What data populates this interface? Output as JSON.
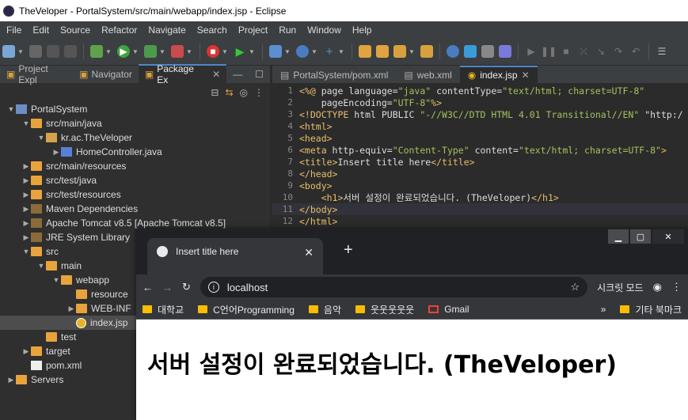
{
  "window": {
    "title": "TheVeloper - PortalSystem/src/main/webapp/index.jsp - Eclipse"
  },
  "menu": [
    "File",
    "Edit",
    "Source",
    "Refactor",
    "Navigate",
    "Search",
    "Project",
    "Run",
    "Window",
    "Help"
  ],
  "left_tabs": [
    {
      "label": "Project Expl"
    },
    {
      "label": "Navigator"
    },
    {
      "label": "Package Ex"
    }
  ],
  "tree": [
    {
      "indent": 0,
      "arrow": "▼",
      "icon": "proj",
      "label": "PortalSystem"
    },
    {
      "indent": 1,
      "arrow": "▼",
      "icon": "folder",
      "label": "src/main/java"
    },
    {
      "indent": 2,
      "arrow": "▼",
      "icon": "pkg",
      "label": "kr.ac.TheVeloper"
    },
    {
      "indent": 3,
      "arrow": "▶",
      "icon": "javaf",
      "label": "HomeController.java"
    },
    {
      "indent": 1,
      "arrow": "▶",
      "icon": "folder",
      "label": "src/main/resources"
    },
    {
      "indent": 1,
      "arrow": "▶",
      "icon": "folder",
      "label": "src/test/java"
    },
    {
      "indent": 1,
      "arrow": "▶",
      "icon": "folder",
      "label": "src/test/resources"
    },
    {
      "indent": 1,
      "arrow": "▶",
      "icon": "jar",
      "label": "Maven Dependencies"
    },
    {
      "indent": 1,
      "arrow": "▶",
      "icon": "jar",
      "label": "Apache Tomcat v8.5 [Apache Tomcat v8.5]"
    },
    {
      "indent": 1,
      "arrow": "▶",
      "icon": "jar",
      "label": "JRE System Library"
    },
    {
      "indent": 1,
      "arrow": "▼",
      "icon": "folder",
      "label": "src"
    },
    {
      "indent": 2,
      "arrow": "▼",
      "icon": "folder",
      "label": "main"
    },
    {
      "indent": 3,
      "arrow": "▼",
      "icon": "folder",
      "label": "webapp"
    },
    {
      "indent": 4,
      "arrow": "",
      "icon": "folder",
      "label": "resource"
    },
    {
      "indent": 4,
      "arrow": "▶",
      "icon": "folder",
      "label": "WEB-INF"
    },
    {
      "indent": 4,
      "arrow": "",
      "icon": "globe",
      "label": "index.jsp",
      "selected": true
    },
    {
      "indent": 2,
      "arrow": "",
      "icon": "folder",
      "label": "test"
    },
    {
      "indent": 1,
      "arrow": "▶",
      "icon": "folder",
      "label": "target"
    },
    {
      "indent": 1,
      "arrow": "",
      "icon": "file",
      "label": "pom.xml"
    },
    {
      "indent": 0,
      "arrow": "▶",
      "icon": "folder",
      "label": "Servers"
    }
  ],
  "editor_tabs": [
    {
      "label": "PortalSystem/pom.xml"
    },
    {
      "label": "web.xml"
    },
    {
      "label": "index.jsp",
      "active": true
    }
  ],
  "code": [
    {
      "n": "1",
      "text": "<%@ page language=\"java\" contentType=\"text/html; charset=UTF-8\""
    },
    {
      "n": "2",
      "text": "    pageEncoding=\"UTF-8\"%>"
    },
    {
      "n": "3",
      "text": "<!DOCTYPE html PUBLIC \"-//W3C//DTD HTML 4.01 Transitional//EN\" \"http:/"
    },
    {
      "n": "4",
      "text": "<html>"
    },
    {
      "n": "5",
      "text": "<head>"
    },
    {
      "n": "6",
      "text": "<meta http-equiv=\"Content-Type\" content=\"text/html; charset=UTF-8\">"
    },
    {
      "n": "7",
      "text": "<title>Insert title here</title>"
    },
    {
      "n": "8",
      "text": "</head>"
    },
    {
      "n": "9",
      "text": "<body>"
    },
    {
      "n": "10",
      "text": "    <h1>서버 설정이 완료되었습니다. (TheVeloper)</h1>"
    },
    {
      "n": "11",
      "text": "</body>"
    },
    {
      "n": "12",
      "text": "</html>"
    }
  ],
  "browser": {
    "tab_title": "Insert title here",
    "url": "localhost",
    "incognito": "시크릿 모드",
    "bookmarks": [
      {
        "label": "대학교"
      },
      {
        "label": "C언어Programming"
      },
      {
        "label": "음악"
      },
      {
        "label": "웃웃웃웃웃"
      },
      {
        "label": "Gmail"
      }
    ],
    "other_bookmarks": "기타 북마크",
    "heading": "서버 설정이 완료되었습니다. (TheVeloper)"
  }
}
